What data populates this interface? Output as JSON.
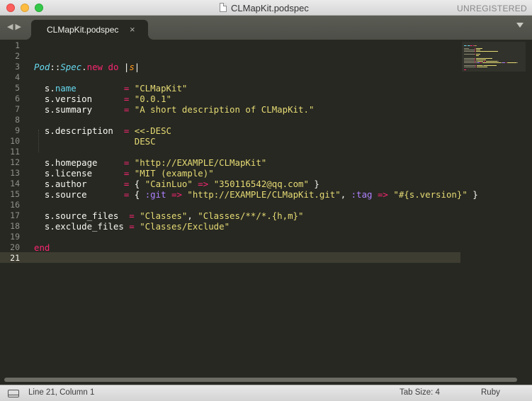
{
  "window": {
    "title": "CLMapKit.podspec",
    "license_status": "UNREGISTERED"
  },
  "tabs": [
    {
      "label": "CLMapKit.podspec",
      "close_glyph": "×",
      "active": true
    }
  ],
  "nav": {
    "back_glyph": "◀",
    "forward_glyph": "▶"
  },
  "editor": {
    "current_line": 21,
    "line_numbers": [
      "1",
      "2",
      "3",
      "4",
      "5",
      "6",
      "7",
      "8",
      "9",
      "10",
      "11",
      "12",
      "13",
      "14",
      "15",
      "16",
      "17",
      "18",
      "19",
      "20",
      "21"
    ],
    "code": [
      {
        "tokens": []
      },
      {
        "tokens": []
      },
      {
        "tokens": [
          {
            "t": "Pod",
            "c": "cls"
          },
          {
            "t": "::",
            "c": "plain"
          },
          {
            "t": "Spec",
            "c": "cls"
          },
          {
            "t": ".",
            "c": "plain"
          },
          {
            "t": "new",
            "c": "kw"
          },
          {
            "t": " ",
            "c": "plain"
          },
          {
            "t": "do",
            "c": "kw"
          },
          {
            "t": " |",
            "c": "plain"
          },
          {
            "t": "s",
            "c": "param"
          },
          {
            "t": "|",
            "c": "plain"
          }
        ]
      },
      {
        "tokens": []
      },
      {
        "tokens": [
          {
            "t": "  s.",
            "c": "plain"
          },
          {
            "t": "name",
            "c": "meth"
          },
          {
            "t": "         ",
            "c": "plain"
          },
          {
            "t": "=",
            "c": "kw"
          },
          {
            "t": " ",
            "c": "plain"
          },
          {
            "t": "\"CLMapKit\"",
            "c": "str"
          }
        ]
      },
      {
        "tokens": [
          {
            "t": "  s.version      ",
            "c": "plain"
          },
          {
            "t": "=",
            "c": "kw"
          },
          {
            "t": " ",
            "c": "plain"
          },
          {
            "t": "\"0.0.1\"",
            "c": "str"
          }
        ]
      },
      {
        "tokens": [
          {
            "t": "  s.summary      ",
            "c": "plain"
          },
          {
            "t": "=",
            "c": "kw"
          },
          {
            "t": " ",
            "c": "plain"
          },
          {
            "t": "\"A short description of CLMapKit.\"",
            "c": "str"
          }
        ]
      },
      {
        "tokens": []
      },
      {
        "tokens": [
          {
            "t": "  s.description  ",
            "c": "plain"
          },
          {
            "t": "=",
            "c": "kw"
          },
          {
            "t": " ",
            "c": "plain"
          },
          {
            "t": "<<-DESC",
            "c": "str"
          }
        ]
      },
      {
        "tokens": [
          {
            "t": "                   ",
            "c": "plain"
          },
          {
            "t": "DESC",
            "c": "str"
          }
        ]
      },
      {
        "tokens": []
      },
      {
        "tokens": [
          {
            "t": "  s.homepage     ",
            "c": "plain"
          },
          {
            "t": "=",
            "c": "kw"
          },
          {
            "t": " ",
            "c": "plain"
          },
          {
            "t": "\"http://EXAMPLE/CLMapKit\"",
            "c": "str"
          }
        ]
      },
      {
        "tokens": [
          {
            "t": "  s.license      ",
            "c": "plain"
          },
          {
            "t": "=",
            "c": "kw"
          },
          {
            "t": " ",
            "c": "plain"
          },
          {
            "t": "\"MIT (example)\"",
            "c": "str"
          }
        ]
      },
      {
        "tokens": [
          {
            "t": "  s.author       ",
            "c": "plain"
          },
          {
            "t": "=",
            "c": "kw"
          },
          {
            "t": " { ",
            "c": "plain"
          },
          {
            "t": "\"CainLuo\"",
            "c": "str"
          },
          {
            "t": " ",
            "c": "plain"
          },
          {
            "t": "=>",
            "c": "kw"
          },
          {
            "t": " ",
            "c": "plain"
          },
          {
            "t": "\"350116542@qq.com\"",
            "c": "str"
          },
          {
            "t": " }",
            "c": "plain"
          }
        ]
      },
      {
        "tokens": [
          {
            "t": "  s.source       ",
            "c": "plain"
          },
          {
            "t": "=",
            "c": "kw"
          },
          {
            "t": " { ",
            "c": "plain"
          },
          {
            "t": ":git",
            "c": "sym"
          },
          {
            "t": " ",
            "c": "plain"
          },
          {
            "t": "=>",
            "c": "kw"
          },
          {
            "t": " ",
            "c": "plain"
          },
          {
            "t": "\"http://EXAMPLE/CLMapKit.git\"",
            "c": "str"
          },
          {
            "t": ", ",
            "c": "plain"
          },
          {
            "t": ":tag",
            "c": "sym"
          },
          {
            "t": " ",
            "c": "plain"
          },
          {
            "t": "=>",
            "c": "kw"
          },
          {
            "t": " ",
            "c": "plain"
          },
          {
            "t": "\"#{s.version}\"",
            "c": "str"
          },
          {
            "t": " }",
            "c": "plain"
          }
        ]
      },
      {
        "tokens": []
      },
      {
        "tokens": [
          {
            "t": "  s.source_files  ",
            "c": "plain"
          },
          {
            "t": "=",
            "c": "kw"
          },
          {
            "t": " ",
            "c": "plain"
          },
          {
            "t": "\"Classes\"",
            "c": "str"
          },
          {
            "t": ", ",
            "c": "plain"
          },
          {
            "t": "\"Classes/**/*.{h,m}\"",
            "c": "str"
          }
        ]
      },
      {
        "tokens": [
          {
            "t": "  s.exclude_files ",
            "c": "plain"
          },
          {
            "t": "=",
            "c": "kw"
          },
          {
            "t": " ",
            "c": "plain"
          },
          {
            "t": "\"Classes/Exclude\"",
            "c": "str"
          }
        ]
      },
      {
        "tokens": []
      },
      {
        "tokens": [
          {
            "t": "end",
            "c": "kw"
          }
        ]
      },
      {
        "tokens": []
      }
    ]
  },
  "status": {
    "position": "Line 21, Column 1",
    "tab_size": "Tab Size: 4",
    "syntax": "Ruby"
  },
  "colors": {
    "background": "#272822",
    "keyword": "#f92672",
    "string": "#e6db74",
    "class": "#66d9ef",
    "symbol": "#ae81ff",
    "parameter": "#fd971f",
    "line_highlight": "#3e3d32"
  },
  "icons": {
    "panel": "panel-toggle-icon",
    "dropdown": "tab-dropdown-icon",
    "document": "document-icon"
  }
}
